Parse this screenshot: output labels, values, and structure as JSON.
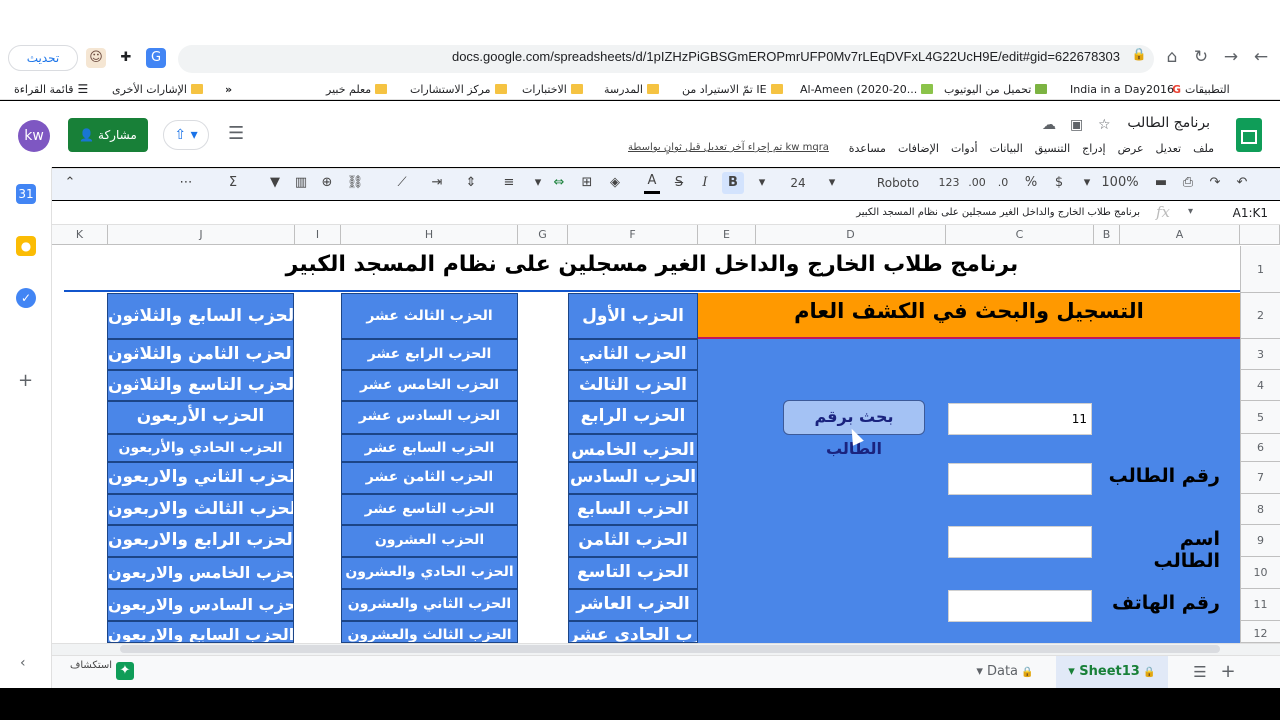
{
  "browser": {
    "url": "docs.google.com/spreadsheets/d/1pIZHzPiGBSGmEROPmrUFP0Mv7rLEqDVFxL4G22UcH9E/edit#gid=622678303",
    "update_label": "تحديث",
    "bookmarks": [
      "التطبيقات",
      "India in a Day2016",
      "تحميل من اليوتيوب",
      "Al-Ameen (2020-20...",
      "تمّ الاستيراد من IE",
      "المدرسة",
      "الاختبارات",
      "مركز الاستشارات",
      "معلم خبير",
      "»",
      "الإشارات الأخرى",
      "قائمة القراءة"
    ]
  },
  "sheets": {
    "title": "برنامج الطالب",
    "menus": [
      "ملف",
      "تعديل",
      "عرض",
      "إدراج",
      "التنسيق",
      "البيانات",
      "أدوات",
      "الإضافات",
      "مساعدة"
    ],
    "last_edit": "تم إجراء آخر تعديل قبل ثوانٍ بواسطة kw mqra",
    "share_label": "مشاركة",
    "avatar": "kw",
    "toolbar": {
      "zoom": "100%",
      "currency": "$",
      "percent": "%",
      "dec0": ".0",
      "dec00": ".00",
      "format123": "123",
      "font": "Roboto",
      "font_size": "24",
      "bold": "B",
      "italic": "I",
      "strike": "S",
      "text_color": "A",
      "sigma": "Σ"
    },
    "formula_bar": {
      "cell_ref": "A1:K1",
      "fx": "fx",
      "content": "برنامج طلاب الخارج والداخل الغير مسجلين على نظام المسجد الكبير"
    },
    "columns": [
      "K",
      "J",
      "I",
      "H",
      "G",
      "F",
      "E",
      "D",
      "C",
      "B",
      "A"
    ],
    "rows": [
      "1",
      "2",
      "3",
      "4",
      "5",
      "6",
      "7",
      "8",
      "9",
      "10",
      "11",
      "12"
    ],
    "title_cell": "برنامج طلاب الخارج والداخل الغير مسجلين على نظام المسجد الكبير",
    "panel": {
      "header": "التسجيل والبحث في الكشف العام",
      "search_button": "بحث برقم الطالب",
      "search_value": "11",
      "label_student_no": "رقم الطالب",
      "label_student_name": "اسم الطالب",
      "label_phone": "رقم الهاتف"
    },
    "colF": [
      "الحزب الأول",
      "الحزب الثاني",
      "الحزب الثالث",
      "الحزب الرابع",
      "الحزب الخامس",
      "الحزب السادس",
      "الحزب السابع",
      "الحزب الثامن",
      "الحزب التاسع",
      "الحزب العاشر",
      "الحزب الحادي عشر"
    ],
    "colH": [
      "الحزب الثالث عشر",
      "الحزب الرابع عشر",
      "الحزب الخامس عشر",
      "الحزب السادس عشر",
      "الحزب السابع عشر",
      "الحزب الثامن عشر",
      "الحزب التاسع عشر",
      "الحزب العشرون",
      "الحزب الحادي والعشرون",
      "الحزب الثاني والعشرون",
      "الحزب الثالث والعشرون"
    ],
    "colJ": [
      "الحزب السابع والثلاثون",
      "الحزب الثامن والثلاثون",
      "الحزب التاسع والثلاثون",
      "الحزب الأربعون",
      "الحزب الحادي والأربعون",
      "الحزب الثاني والاربعون",
      "الحزب الثالث والاربعون",
      "الحزب الرابع والاربعون",
      "الحزب الخامس والاربعون",
      "الحزب السادس والاربعون",
      "الحزب السابع والاربعون"
    ],
    "tabs": {
      "sheet_active": "Sheet13",
      "sheet_other": "Data",
      "explore": "استكشاف"
    }
  },
  "colors": {
    "panel_blue": "#4a86e8",
    "orange": "#ff9900",
    "share_green": "#188038"
  }
}
